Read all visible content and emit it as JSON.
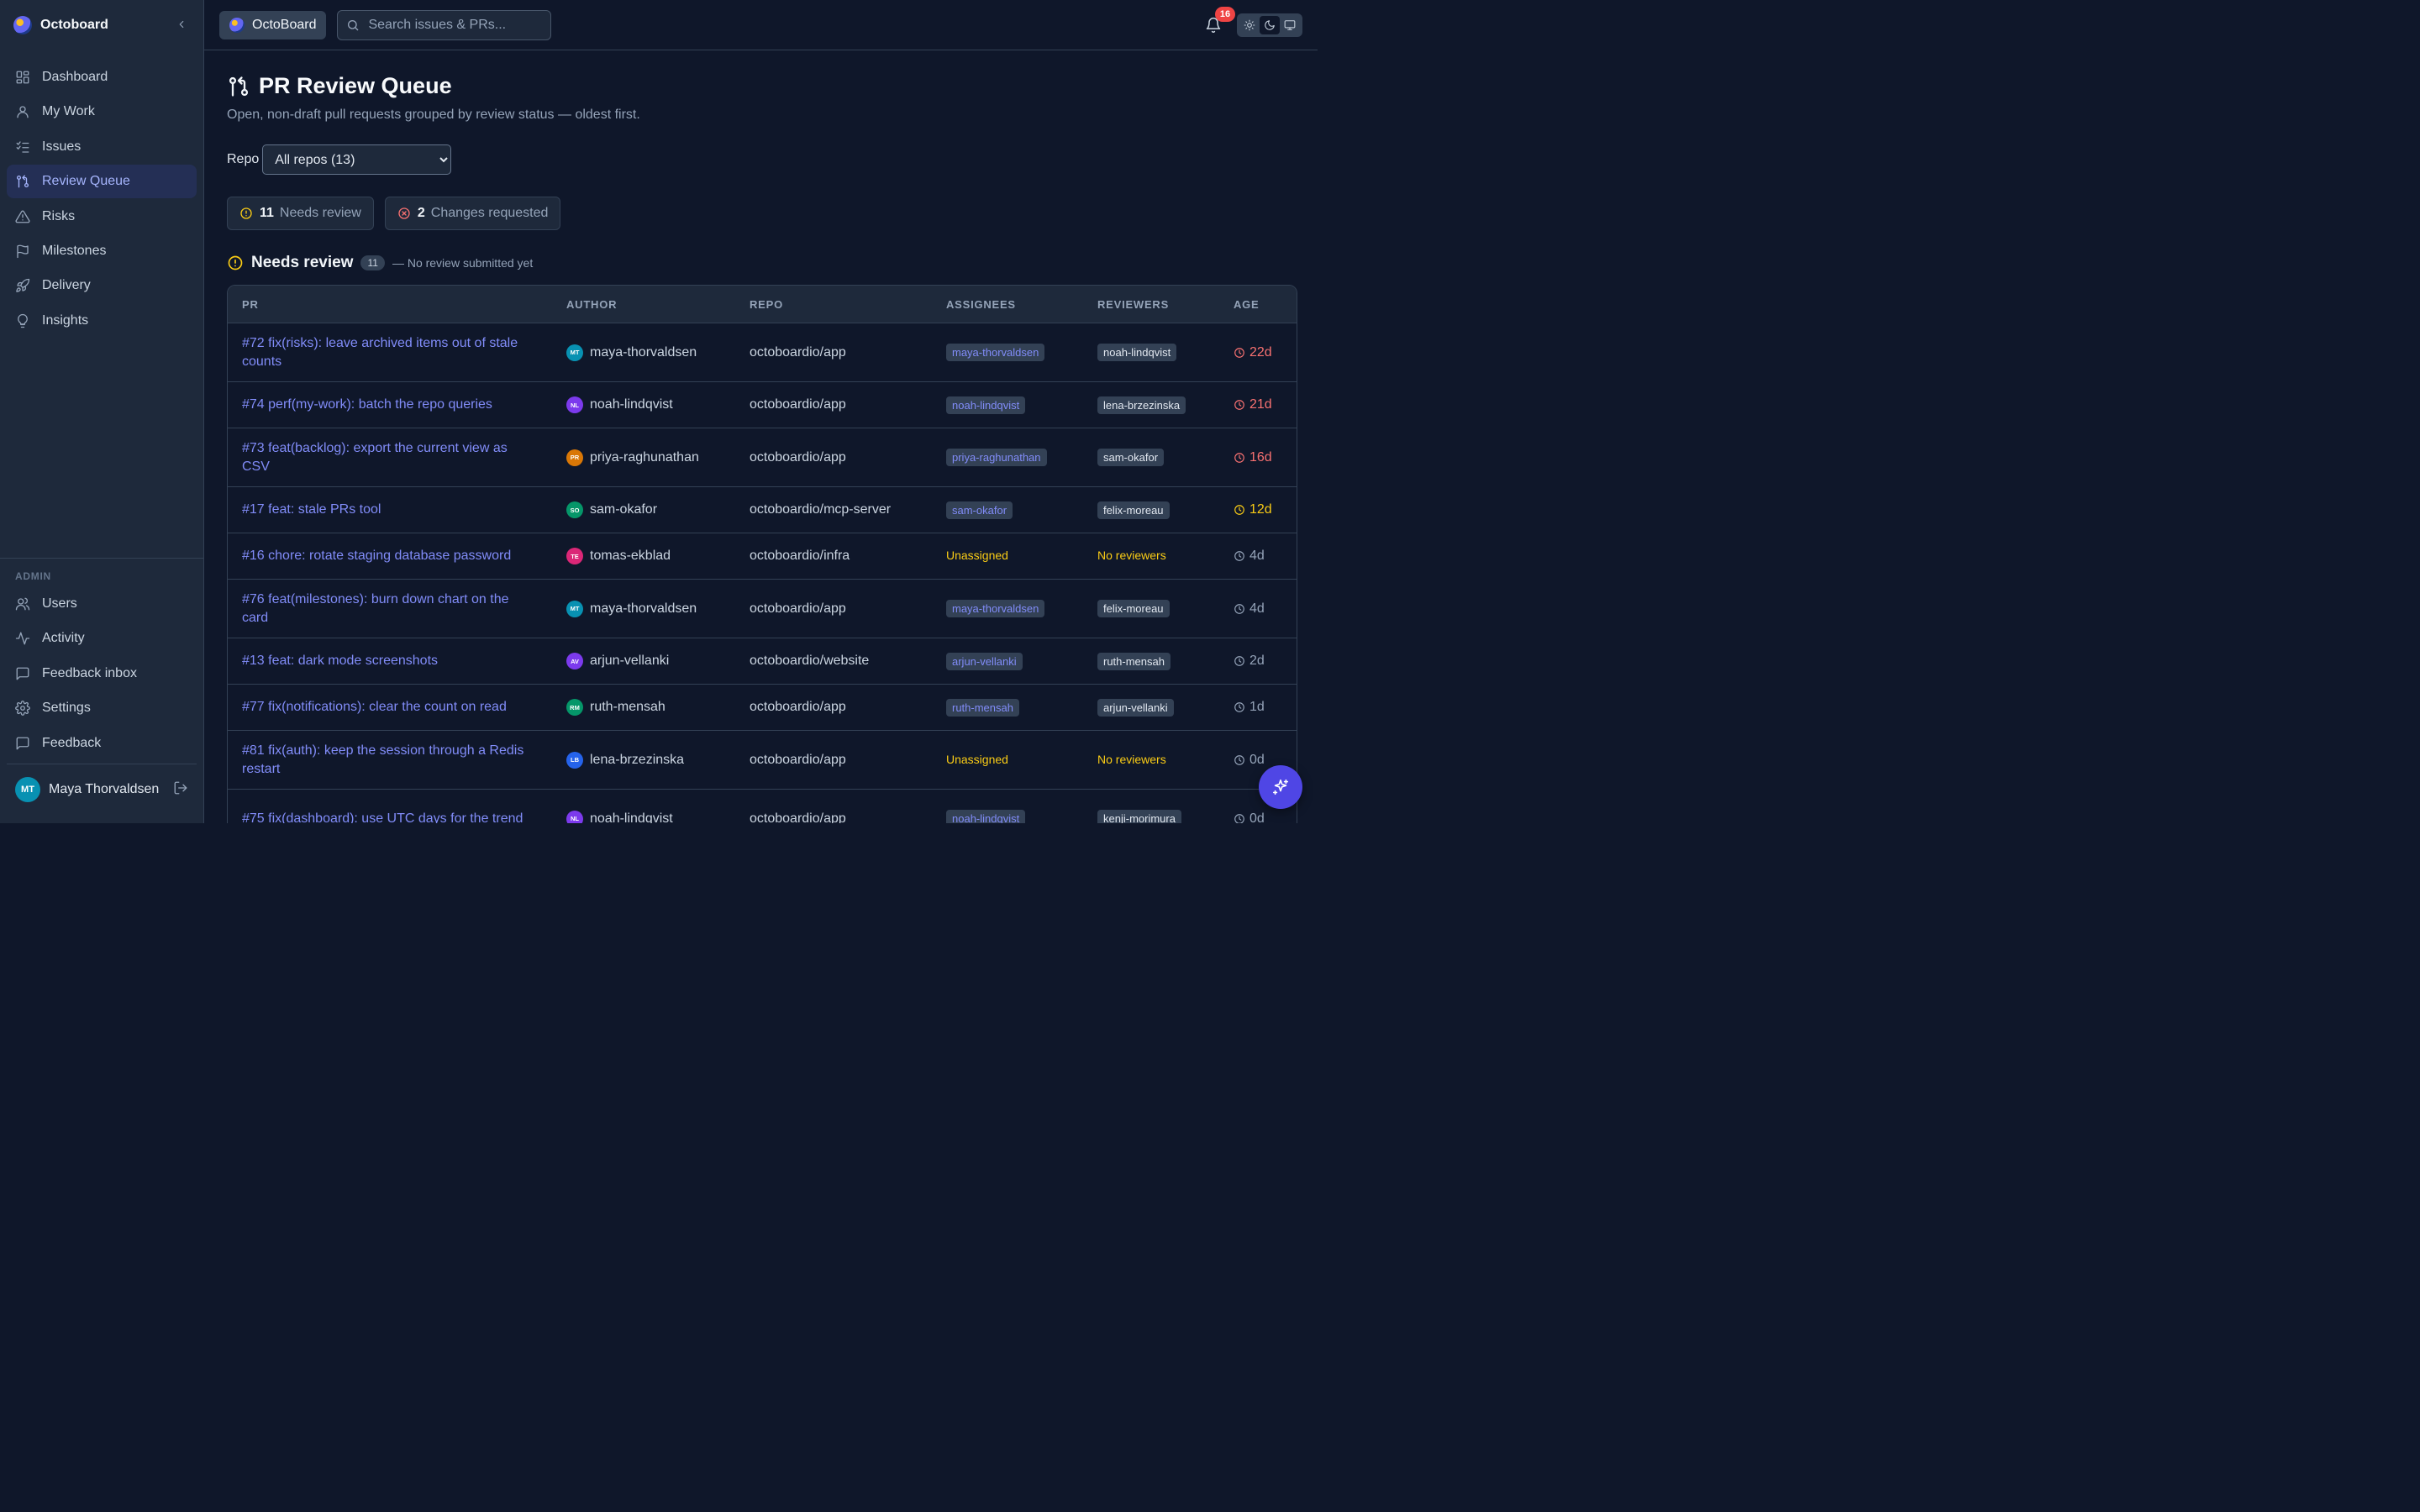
{
  "app": {
    "name": "Octoboard"
  },
  "sidebar": {
    "nav": [
      {
        "label": "Dashboard",
        "icon": "grid-icon"
      },
      {
        "label": "My Work",
        "icon": "user-icon"
      },
      {
        "label": "Issues",
        "icon": "list-check-icon"
      },
      {
        "label": "Review Queue",
        "icon": "git-pull-request-icon",
        "active": true
      },
      {
        "label": "Risks",
        "icon": "alert-triangle-icon"
      },
      {
        "label": "Milestones",
        "icon": "flag-icon"
      },
      {
        "label": "Delivery",
        "icon": "rocket-icon"
      },
      {
        "label": "Insights",
        "icon": "lightbulb-icon"
      }
    ],
    "admin_label": "ADMIN",
    "admin": [
      {
        "label": "Users",
        "icon": "users-icon"
      },
      {
        "label": "Activity",
        "icon": "activity-icon"
      },
      {
        "label": "Feedback inbox",
        "icon": "message-icon"
      },
      {
        "label": "Settings",
        "icon": "gear-icon"
      },
      {
        "label": "Feedback",
        "icon": "message-icon"
      }
    ],
    "user": {
      "initials": "MT",
      "name": "Maya Thorvaldsen"
    }
  },
  "topbar": {
    "org": "OctoBoard",
    "search_placeholder": "Search issues & PRs...",
    "notifications": "16"
  },
  "page": {
    "title": "PR Review Queue",
    "subtitle": "Open, non-draft pull requests grouped by review status — oldest first.",
    "repo_label": "Repo",
    "repo_selected": "All repos (13)",
    "stats": [
      {
        "num": "11",
        "label": "Needs review",
        "color": "#facc15"
      },
      {
        "num": "2",
        "label": "Changes requested",
        "color": "#f87171"
      }
    ],
    "section": {
      "title": "Needs review",
      "count": "11",
      "note": "— No review submitted yet"
    },
    "columns": [
      "PR",
      "AUTHOR",
      "REPO",
      "ASSIGNEES",
      "REVIEWERS",
      "AGE"
    ],
    "rows": [
      {
        "pr": "#72 fix(risks): leave archived items out of stale counts",
        "initials": "MT",
        "av": "#0891b2",
        "author": "maya-thorvaldsen",
        "repo": "octoboardio/app",
        "assignee": "maya-thorvaldsen",
        "reviewer": "noah-lindqvist",
        "age": "22d",
        "age_level": "red",
        "tall": true
      },
      {
        "pr": "#74 perf(my-work): batch the repo queries",
        "initials": "NL",
        "av": "#7c3aed",
        "author": "noah-lindqvist",
        "repo": "octoboardio/app",
        "assignee": "noah-lindqvist",
        "reviewer": "lena-brzezinska",
        "age": "21d",
        "age_level": "red",
        "tall": false
      },
      {
        "pr": "#73 feat(backlog): export the current view as CSV",
        "initials": "PR",
        "av": "#d97706",
        "author": "priya-raghunathan",
        "repo": "octoboardio/app",
        "assignee": "priya-raghunathan",
        "reviewer": "sam-okafor",
        "age": "16d",
        "age_level": "red",
        "tall": true
      },
      {
        "pr": "#17 feat: stale PRs tool",
        "initials": "SO",
        "av": "#059669",
        "author": "sam-okafor",
        "repo": "octoboardio/mcp-server",
        "assignee": "sam-okafor",
        "reviewer": "felix-moreau",
        "age": "12d",
        "age_level": "amber",
        "tall": false
      },
      {
        "pr": "#16 chore: rotate staging database password",
        "initials": "TE",
        "av": "#db2777",
        "author": "tomas-ekblad",
        "repo": "octoboardio/infra",
        "assignee": "",
        "reviewer": "",
        "age": "4d",
        "age_level": "gray",
        "tall": false
      },
      {
        "pr": "#76 feat(milestones): burn down chart on the card",
        "initials": "MT",
        "av": "#0891b2",
        "author": "maya-thorvaldsen",
        "repo": "octoboardio/app",
        "assignee": "maya-thorvaldsen",
        "reviewer": "felix-moreau",
        "age": "4d",
        "age_level": "gray",
        "tall": true
      },
      {
        "pr": "#13 feat: dark mode screenshots",
        "initials": "AV",
        "av": "#7c3aed",
        "author": "arjun-vellanki",
        "repo": "octoboardio/website",
        "assignee": "arjun-vellanki",
        "reviewer": "ruth-mensah",
        "age": "2d",
        "age_level": "gray",
        "tall": false
      },
      {
        "pr": "#77 fix(notifications): clear the count on read",
        "initials": "RM",
        "av": "#059669",
        "author": "ruth-mensah",
        "repo": "octoboardio/app",
        "assignee": "ruth-mensah",
        "reviewer": "arjun-vellanki",
        "age": "1d",
        "age_level": "gray",
        "tall": false
      },
      {
        "pr": "#81 fix(auth): keep the session through a Redis restart",
        "initials": "LB",
        "av": "#2563eb",
        "author": "lena-brzezinska",
        "repo": "octoboardio/app",
        "assignee": "",
        "reviewer": "",
        "age": "0d",
        "age_level": "gray",
        "tall": true
      },
      {
        "pr": "#75 fix(dashboard): use UTC days for the trend",
        "initials": "NL",
        "av": "#7c3aed",
        "author": "noah-lindqvist",
        "repo": "octoboardio/app",
        "assignee": "noah-lindqvist",
        "reviewer": "kenji-morimura",
        "age": "0d",
        "age_level": "gray",
        "tall": true
      }
    ],
    "unassigned_label": "Unassigned",
    "no_reviewers_label": "No reviewers"
  }
}
